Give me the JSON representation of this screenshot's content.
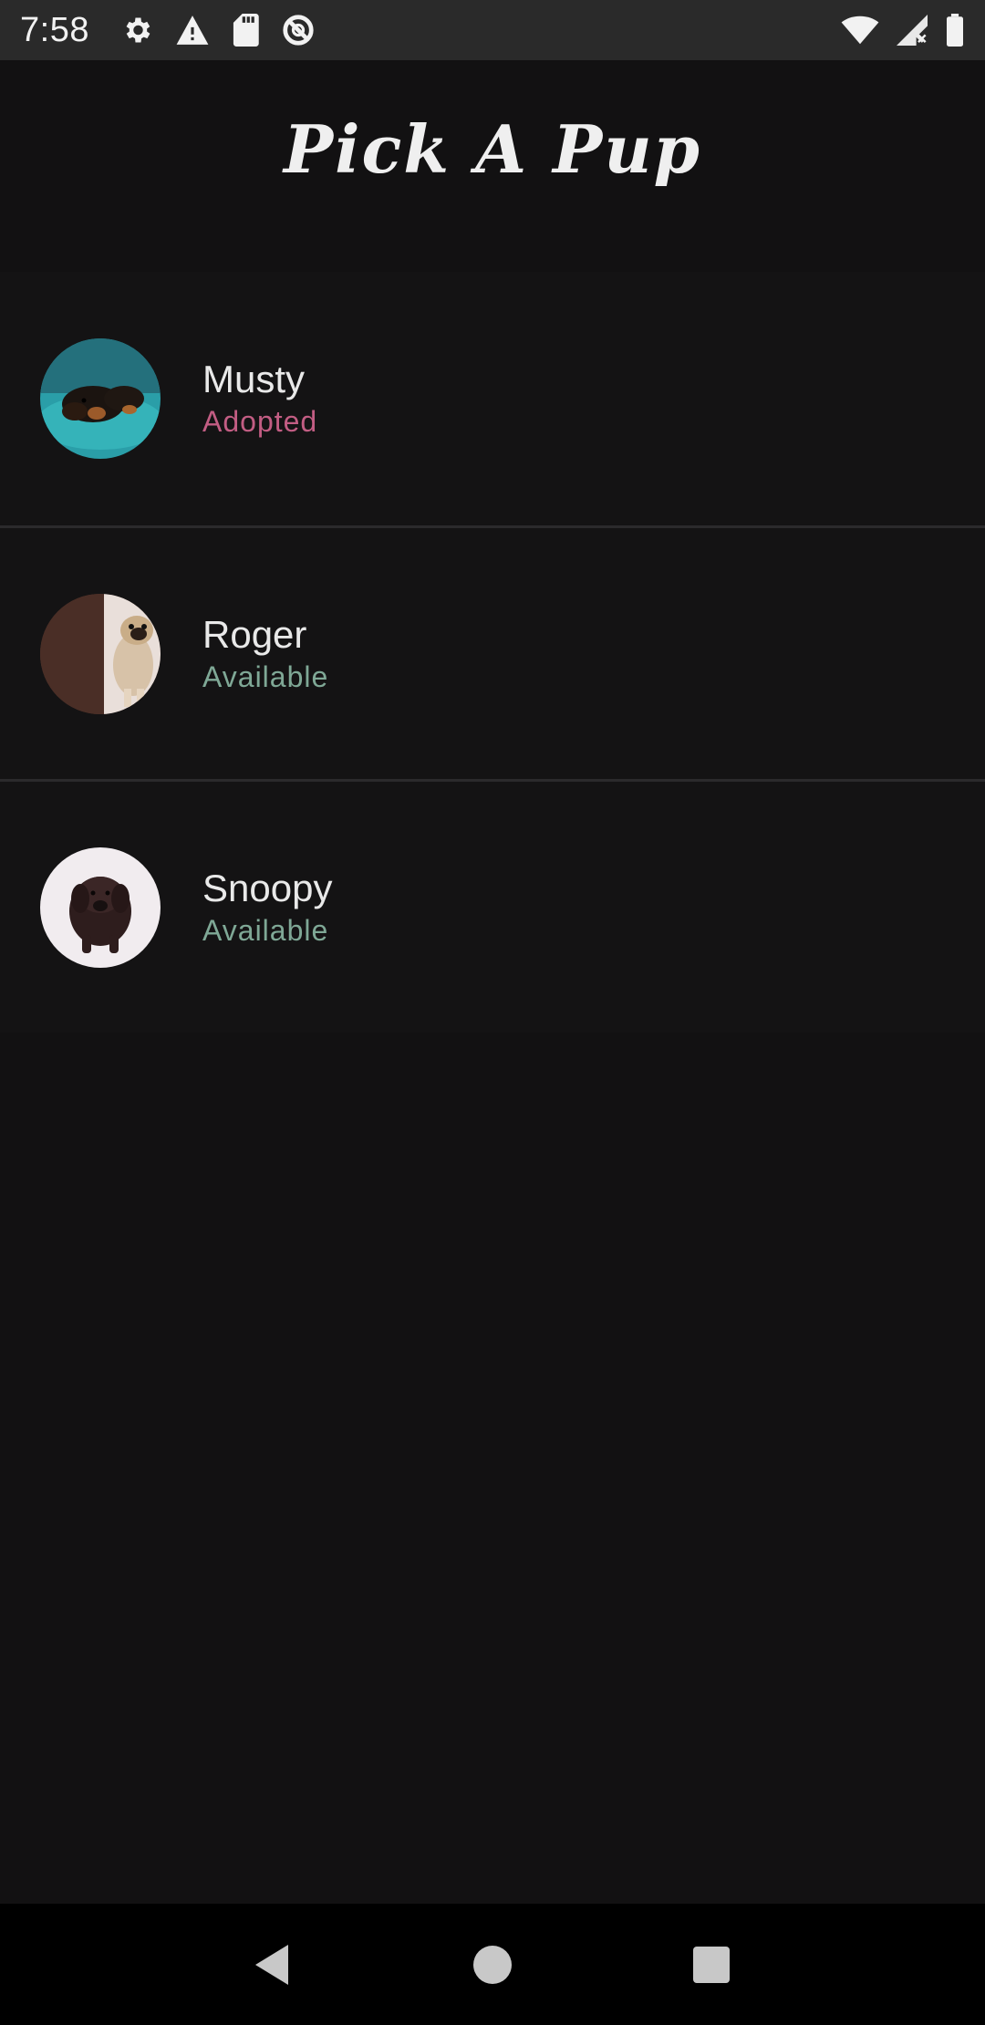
{
  "status_bar": {
    "time": "7:58",
    "icons_left": [
      "gear-icon",
      "warning-icon",
      "sd-card-icon",
      "data-saver-icon"
    ],
    "icons_right": [
      "wifi-icon",
      "signal-icon",
      "battery-icon"
    ]
  },
  "app": {
    "title": "Pick A Pup"
  },
  "pups": [
    {
      "name": "Musty",
      "status": "Adopted",
      "status_color": "#c25d83",
      "avatar": "dachshund-photo"
    },
    {
      "name": "Roger",
      "status": "Available",
      "status_color": "#7fa896",
      "avatar": "pug-photo"
    },
    {
      "name": "Snoopy",
      "status": "Available",
      "status_color": "#7fa896",
      "avatar": "chocolate-lab-photo"
    }
  ],
  "nav_bar": {
    "buttons": [
      "back-icon",
      "home-icon",
      "recents-icon"
    ]
  }
}
